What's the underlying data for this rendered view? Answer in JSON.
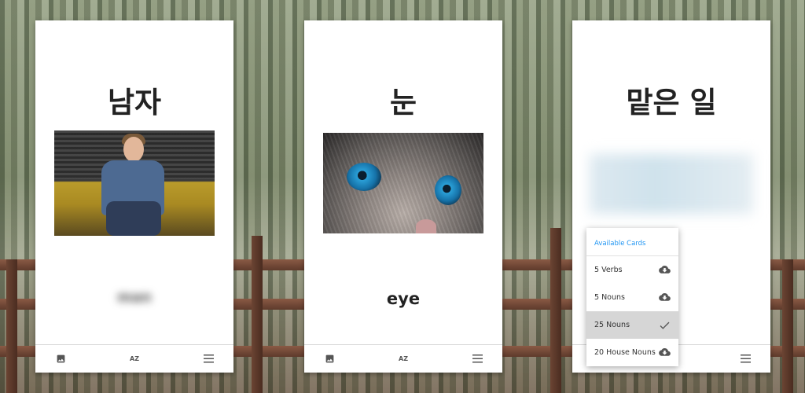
{
  "cards": [
    {
      "word": "남자",
      "answer": "man",
      "answer_hidden": true
    },
    {
      "word": "눈",
      "answer": "eye",
      "answer_hidden": false
    },
    {
      "word": "맡은 일",
      "answer": "",
      "answer_hidden": true
    }
  ],
  "toolbar": {
    "image_icon": "image-icon",
    "sort_icon": "sort-az-icon",
    "sort_label": "AZ",
    "menu_icon": "hamburger-menu-icon"
  },
  "menu": {
    "header": "Available Cards",
    "items": [
      {
        "label": "5 Verbs",
        "icon": "cloud-download-icon",
        "selected": false
      },
      {
        "label": "5 Nouns",
        "icon": "cloud-download-icon",
        "selected": false
      },
      {
        "label": "25 Nouns",
        "icon": "check-icon",
        "selected": true
      },
      {
        "label": "20 House Nouns",
        "icon": "cloud-download-icon",
        "selected": false
      }
    ]
  },
  "colors": {
    "accent": "#2196f3",
    "selected_bg": "#d6d6d6",
    "card_bg": "#ffffff"
  }
}
